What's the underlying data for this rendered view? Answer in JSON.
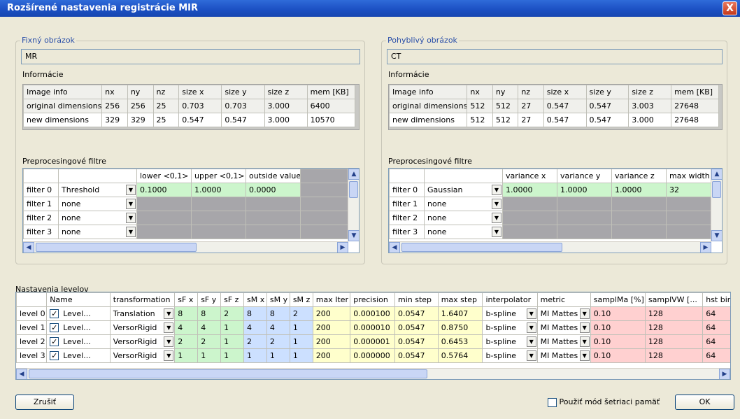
{
  "window": {
    "title": "Rozšírené nastavenia registrácie MIR",
    "close": "X"
  },
  "fixed": {
    "group_title": "Fixný obrázok",
    "name": "MR",
    "info_label": "Informácie",
    "filters_label": "Preprocesingové filtre",
    "info_header": [
      "Image info",
      "nx",
      "ny",
      "nz",
      "size x",
      "size y",
      "size z",
      "mem [KB]"
    ],
    "info_rows": [
      [
        "original dimensions",
        "256",
        "256",
        "25",
        "0.703",
        "0.703",
        "3.000",
        "6400"
      ],
      [
        "new dimensions",
        "329",
        "329",
        "25",
        "0.547",
        "0.547",
        "3.000",
        "10570"
      ]
    ],
    "filter_header": [
      "",
      "",
      "lower <0,1>",
      "upper <0,1>",
      "outside value",
      ""
    ],
    "filters": [
      {
        "label": "filter 0",
        "type": "Threshold",
        "v": [
          "0.1000",
          "1.0000",
          "0.0000"
        ]
      },
      {
        "label": "filter 1",
        "type": "none"
      },
      {
        "label": "filter 2",
        "type": "none"
      },
      {
        "label": "filter 3",
        "type": "none"
      }
    ]
  },
  "moving": {
    "group_title": "Pohyblivý obrázok",
    "name": "CT",
    "info_label": "Informácie",
    "filters_label": "Preprocesingové filtre",
    "info_header": [
      "Image info",
      "nx",
      "ny",
      "nz",
      "size x",
      "size y",
      "size z",
      "mem [KB]"
    ],
    "info_rows": [
      [
        "original dimensions",
        "512",
        "512",
        "27",
        "0.547",
        "0.547",
        "3.003",
        "27648"
      ],
      [
        "new dimensions",
        "512",
        "512",
        "27",
        "0.547",
        "0.547",
        "3.000",
        "27648"
      ]
    ],
    "filter_header": [
      "",
      "",
      "variance x",
      "variance y",
      "variance z",
      "max width"
    ],
    "filters": [
      {
        "label": "filter 0",
        "type": "Gaussian",
        "v": [
          "1.0000",
          "1.0000",
          "1.0000",
          "32"
        ]
      },
      {
        "label": "filter 1",
        "type": "none"
      },
      {
        "label": "filter 2",
        "type": "none"
      },
      {
        "label": "filter 3",
        "type": "none"
      }
    ]
  },
  "levels": {
    "label": "Nastavenia levelov",
    "header": [
      "",
      "Name",
      "transformation",
      "sF x",
      "sF y",
      "sF z",
      "sM x",
      "sM y",
      "sM z",
      "max Iter",
      "precision",
      "min step",
      "max step",
      "interpolator",
      "metric",
      "samplMa [%]",
      "samplVW [...",
      "hst bins"
    ],
    "rows": [
      [
        "level 0",
        "Level...",
        "Translation",
        "8",
        "8",
        "2",
        "8",
        "8",
        "2",
        "200",
        "0.000100",
        "0.0547",
        "1.6407",
        "b-spline",
        "MI Mattes",
        "0.10",
        "128",
        "64"
      ],
      [
        "level 1",
        "Level...",
        "VersorRigid",
        "4",
        "4",
        "1",
        "4",
        "4",
        "1",
        "200",
        "0.000010",
        "0.0547",
        "0.8750",
        "b-spline",
        "MI Mattes",
        "0.10",
        "128",
        "64"
      ],
      [
        "level 2",
        "Level...",
        "VersorRigid",
        "2",
        "2",
        "1",
        "2",
        "2",
        "1",
        "200",
        "0.000001",
        "0.0547",
        "0.6453",
        "b-spline",
        "MI Mattes",
        "0.10",
        "128",
        "64"
      ],
      [
        "level 3",
        "Level...",
        "VersorRigid",
        "1",
        "1",
        "1",
        "1",
        "1",
        "1",
        "200",
        "0.000000",
        "0.0547",
        "0.5764",
        "b-spline",
        "MI Mattes",
        "0.10",
        "128",
        "64"
      ]
    ]
  },
  "buttons": {
    "cancel": "Zrušiť",
    "ok": "OK",
    "memory_checkbox": "Použiť mód šetriaci pamäť"
  }
}
